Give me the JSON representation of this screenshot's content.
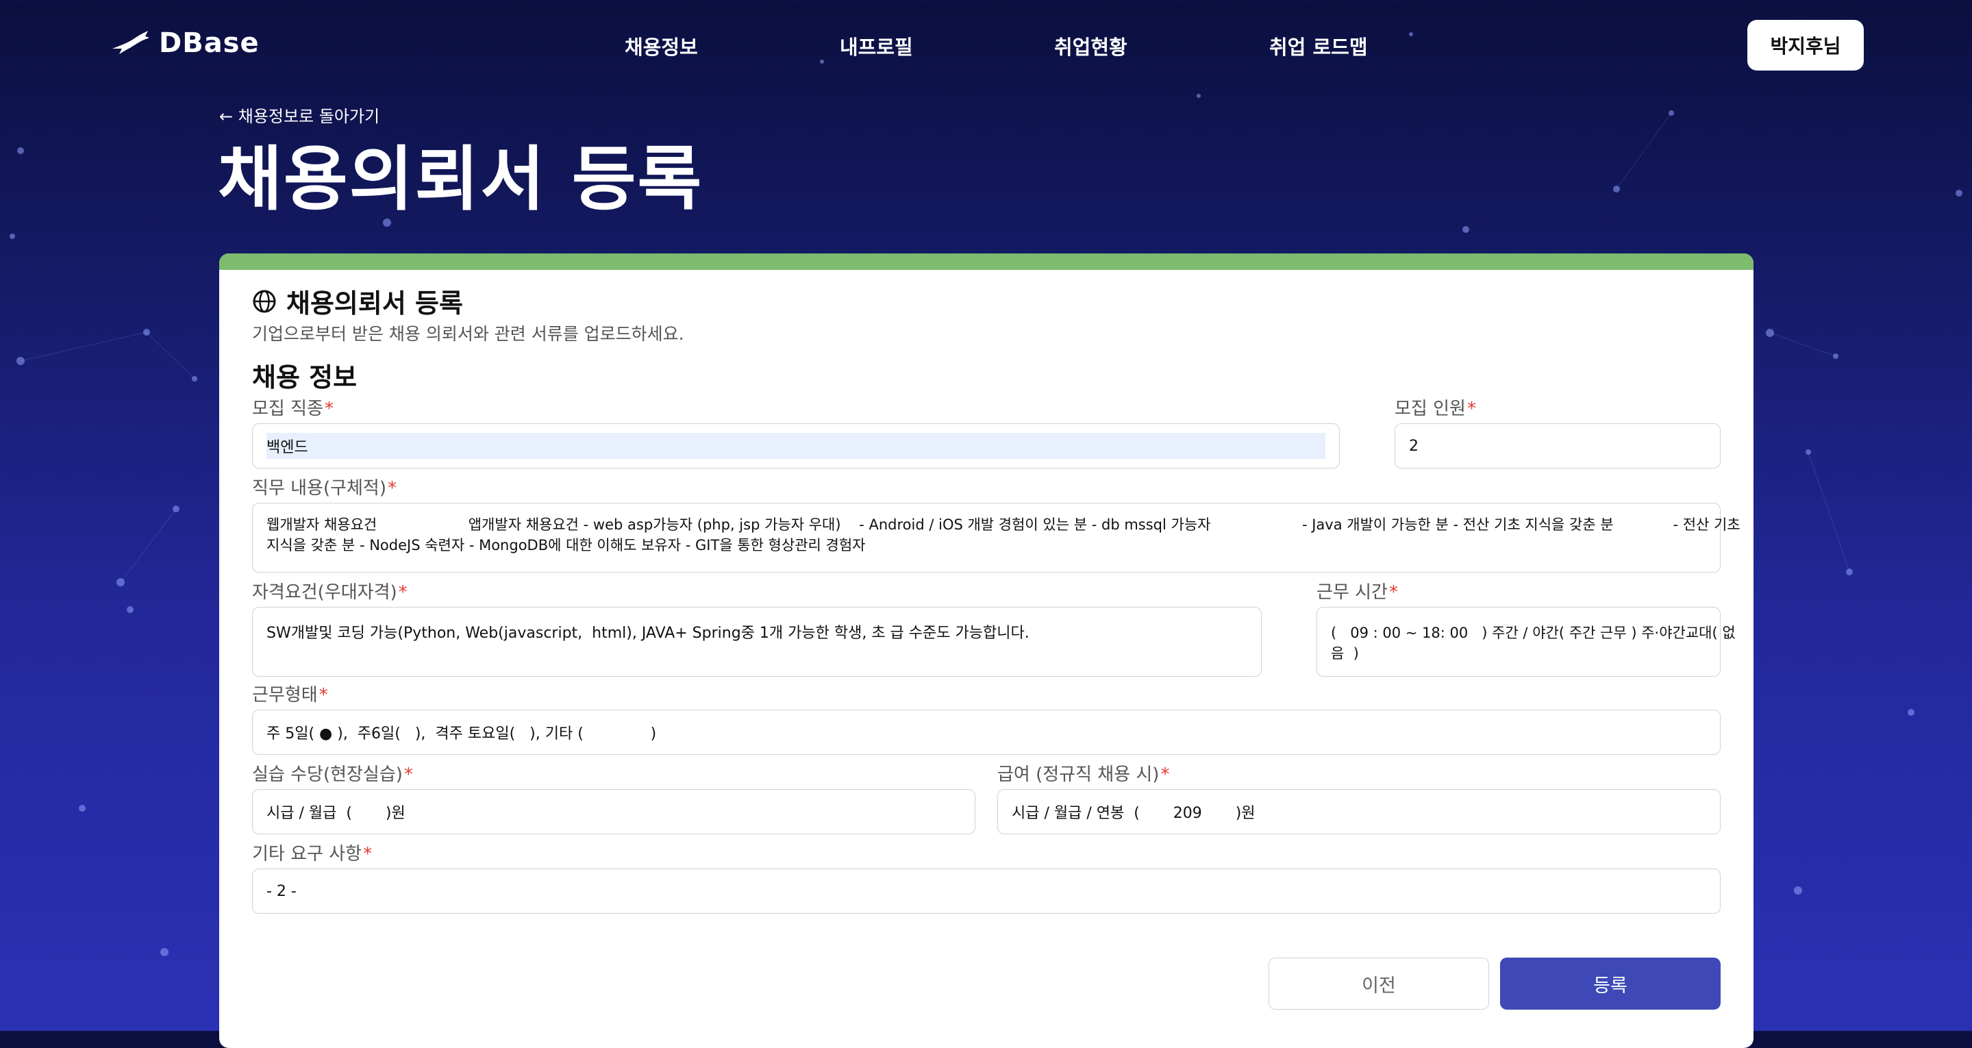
{
  "header": {
    "logo_text": "DBase",
    "nav": [
      "채용정보",
      "내프로필",
      "취업현황",
      "취업 로드맵"
    ],
    "user_button": "박지후님"
  },
  "page": {
    "back_link": "← 채용정보로 돌아가기",
    "title": "채용의뢰서 등록"
  },
  "card": {
    "title": "채용의뢰서 등록",
    "subtitle": "기업으로부터 받은 채용 의뢰서와 관련 서류를 업로드하세요.",
    "section_title": "채용 정보",
    "accent_color": "#7dbb6d"
  },
  "fields": {
    "job_type": {
      "label": "모집 직종",
      "value": "백엔드"
    },
    "headcount": {
      "label": "모집 인원",
      "value": "2"
    },
    "job_detail": {
      "label": "직무 내용(구체적)",
      "value_line1": "웹개발자 채용요건                    앱개발자 채용요건 - web asp가능자 (php, jsp 가능자 우대)    - Android / iOS 개발 경험이 있는 분 - db mssql 가능자                    - Java 개발이 가능한 분 - 전산 기초 지식을 갖춘 분             - 전산 기초",
      "value_line2": "지식을 갖춘 분 - NodeJS 숙련자 - MongoDB에 대한 이해도 보유자 - GIT을 통한 형상관리 경험자"
    },
    "qualification": {
      "label": "자격요건(우대자격)",
      "value": "SW개발및 코딩 가능(Python, Web(javascript,  html), JAVA+ Spring중 1개 가능한 학생, 초 급 수준도 가능합니다."
    },
    "work_hours": {
      "label": "근무 시간",
      "value_line1": "(   09 : 00 ~ 18: 00   ) 주간 / 야간( 주간 근무 ) 주·야간교대( 없",
      "value_line2": "음  )"
    },
    "work_type": {
      "label": "근무형태",
      "value": "주 5일( ● ),  주6일(   ),  격주 토요일(   ), 기타 (              )"
    },
    "intern_pay": {
      "label": "실습 수당(현장실습)",
      "value": "시급 / 월급  (       )원"
    },
    "salary": {
      "label": "급여 (정규직 채용 시)",
      "value": "시급 / 월급 / 연봉  (       209       )원"
    },
    "other": {
      "label": "기타 요구 사항",
      "value": "- 2 -"
    }
  },
  "buttons": {
    "prev": "이전",
    "submit": "등록",
    "submit_color": "#3e49b7"
  }
}
